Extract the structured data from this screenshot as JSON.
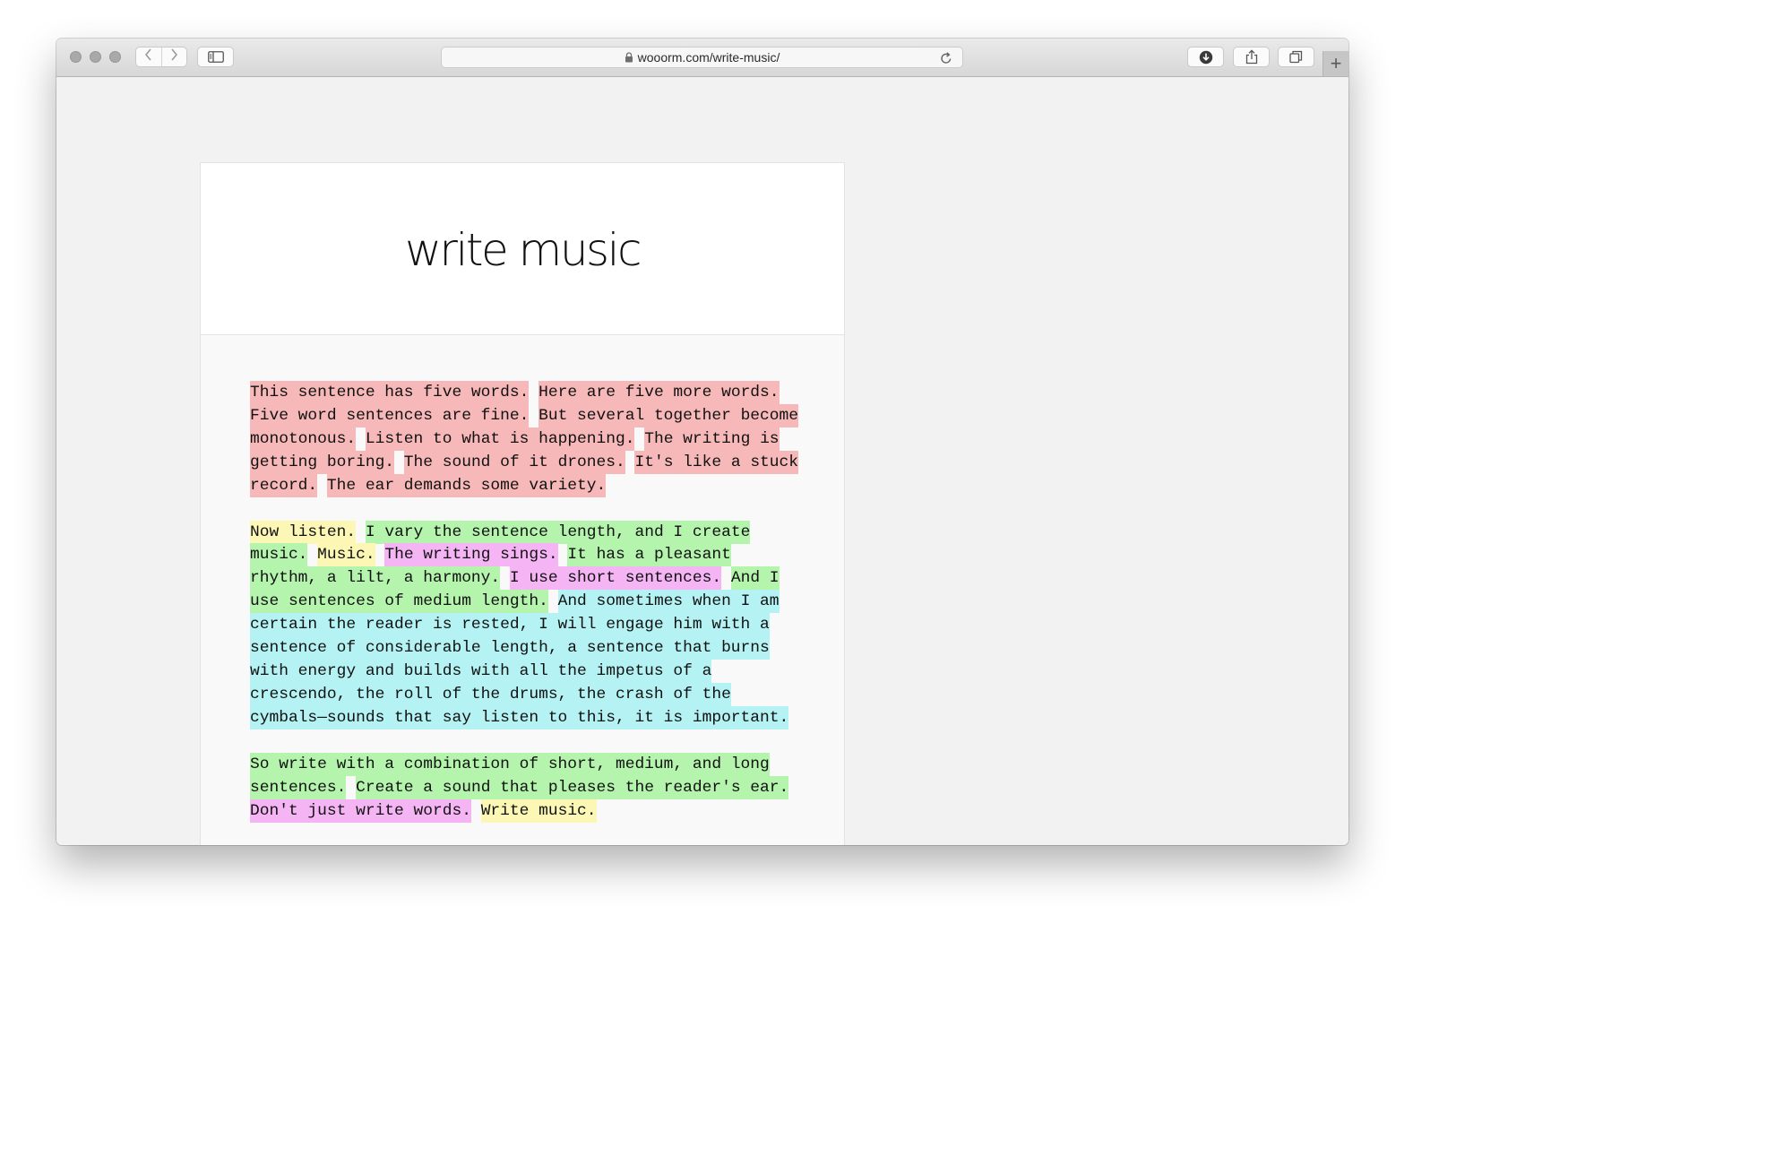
{
  "browser": {
    "url": "wooorm.com/write-music/",
    "icons": {
      "back": "chevron-left-icon",
      "forward": "chevron-right-icon",
      "sidebar": "sidebar-icon",
      "lock": "lock-icon",
      "reload": "reload-icon",
      "downloads": "download-icon",
      "share": "share-icon",
      "tabs": "tabs-overview-icon",
      "new_tab": "plus-icon"
    },
    "new_tab_glyph": "+"
  },
  "page": {
    "title": "write music",
    "colors": {
      "short": "#fdf7b5",
      "five": "#f6b8b8",
      "medium": "#b4f4ad",
      "long": "#b4f2f4",
      "very_short": "#f5b5f5"
    },
    "paragraphs": [
      {
        "sentences": [
          {
            "text": "This sentence has five words.",
            "type": "five"
          },
          {
            "text": "Here are five more words.",
            "type": "five"
          },
          {
            "text": "Five word sentences are fine.",
            "type": "five"
          },
          {
            "text": "But several together become monotonous.",
            "type": "five"
          },
          {
            "text": "Listen to what is happening.",
            "type": "five"
          },
          {
            "text": "The writing is getting boring.",
            "type": "five"
          },
          {
            "text": "The sound of it drones.",
            "type": "five"
          },
          {
            "text": "It's like a stuck record.",
            "type": "five"
          },
          {
            "text": "The ear demands some variety.",
            "type": "five"
          }
        ]
      },
      {
        "sentences": [
          {
            "text": "Now listen.",
            "type": "short"
          },
          {
            "text": "I vary the sentence length, and I create music.",
            "type": "medium"
          },
          {
            "text": "Music.",
            "type": "short"
          },
          {
            "text": "The writing sings.",
            "type": "very_short"
          },
          {
            "text": "It has a pleasant rhythm, a lilt, a harmony.",
            "type": "medium"
          },
          {
            "text": "I use short sentences.",
            "type": "very_short"
          },
          {
            "text": "And I use sentences of medium length.",
            "type": "medium"
          },
          {
            "text": "And sometimes when I am certain the reader is rested, I will engage him with a sentence of considerable length, a sentence that burns with energy and builds with all the impetus of a crescendo, the roll of the drums, the crash of the cymbals—sounds that say listen to this, it is important.",
            "type": "long"
          }
        ]
      },
      {
        "sentences": [
          {
            "text": "So write with a combination of short, medium, and long sentences.",
            "type": "medium"
          },
          {
            "text": "Create a sound that pleases the reader's ear.",
            "type": "medium"
          },
          {
            "text": "Don't just write words.",
            "type": "very_short"
          },
          {
            "text": "Write music.",
            "type": "short"
          }
        ]
      }
    ]
  }
}
